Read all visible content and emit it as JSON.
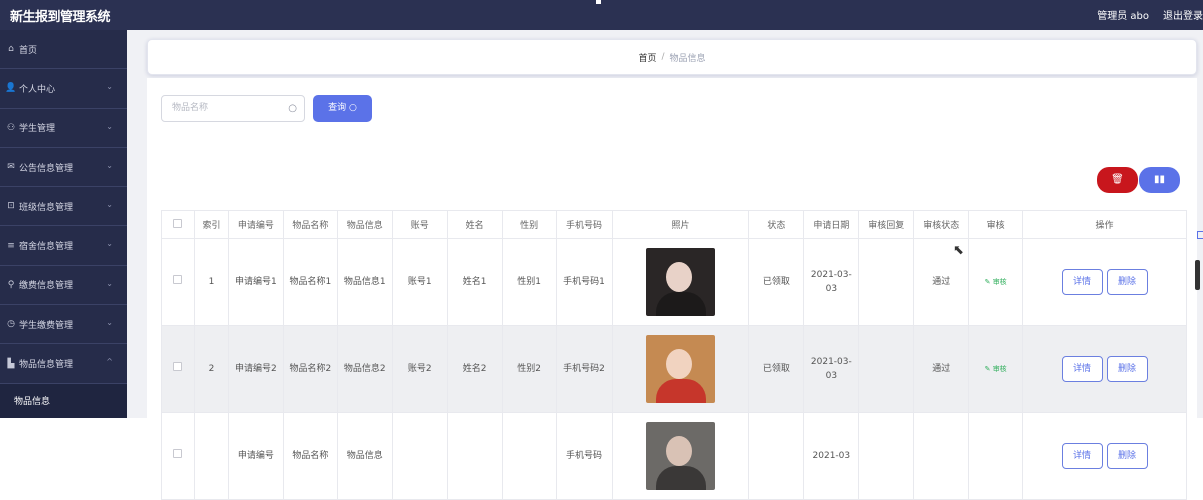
{
  "header": {
    "app_title": "新生报到管理系统",
    "user_label": "管理员 abo",
    "logout": "退出登录"
  },
  "sidebar": {
    "items": [
      {
        "label": "首页",
        "icon": "home-icon",
        "glyph": "⌂",
        "has_chevron": false
      },
      {
        "label": "个人中心",
        "icon": "user-icon",
        "glyph": "👤",
        "has_chevron": true
      },
      {
        "label": "学生管理",
        "icon": "student-icon",
        "glyph": "⚇",
        "has_chevron": true
      },
      {
        "label": "公告信息管理",
        "icon": "mail-icon",
        "glyph": "✉",
        "has_chevron": true
      },
      {
        "label": "班级信息管理",
        "icon": "crop-icon",
        "glyph": "⊡",
        "has_chevron": true
      },
      {
        "label": "宿舍信息管理",
        "icon": "list-icon",
        "glyph": "≡",
        "has_chevron": true
      },
      {
        "label": "缴费信息管理",
        "icon": "bulb-icon",
        "glyph": "⚲",
        "has_chevron": true
      },
      {
        "label": "学生缴费管理",
        "icon": "clock-icon",
        "glyph": "◷",
        "has_chevron": true
      },
      {
        "label": "物品信息管理",
        "icon": "chart-icon",
        "glyph": "▙",
        "has_chevron": true,
        "chevron": "^"
      }
    ],
    "sub_item": "物品信息",
    "chevron_glyph": "⌄"
  },
  "breadcrumb": {
    "home": "首页",
    "separator": "/",
    "current": "物品信息"
  },
  "search": {
    "placeholder": "物品名称",
    "button": "查询"
  },
  "icons": {
    "search": "search-icon",
    "delete": "trash-icon",
    "chart": "bar-chart-icon",
    "cursor": "mouse-cursor-icon"
  },
  "colors": {
    "topbar": "#2b3152",
    "sidebar": "#262c4a",
    "primary": "#5b72e8",
    "danger": "#c8161d",
    "audit_green": "#2fae5b"
  },
  "table": {
    "columns": [
      "索引",
      "申请编号",
      "物品名称",
      "物品信息",
      "账号",
      "姓名",
      "性别",
      "手机号码",
      "照片",
      "状态",
      "申请日期",
      "审核回复",
      "审核状态",
      "审核",
      "操作"
    ],
    "rows": [
      {
        "index": "1",
        "apply_no": "申请编号1",
        "item_name": "物品名称1",
        "item_info": "物品信息1",
        "account": "账号1",
        "name": "姓名1",
        "gender": "性别1",
        "phone": "手机号码1",
        "status": "已领取",
        "date": "2021-03-03",
        "reply": "",
        "audit_status": "通过",
        "audit_action": "审核"
      },
      {
        "index": "2",
        "apply_no": "申请编号2",
        "item_name": "物品名称2",
        "item_info": "物品信息2",
        "account": "账号2",
        "name": "姓名2",
        "gender": "性别2",
        "phone": "手机号码2",
        "status": "已领取",
        "date": "2021-03-03",
        "reply": "",
        "audit_status": "通过",
        "audit_action": "审核"
      },
      {
        "index": "",
        "apply_no": "申请编号",
        "item_name": "物品名称",
        "item_info": "物品信息",
        "account": "",
        "name": "",
        "gender": "",
        "phone": "手机号码",
        "status": "",
        "date": "2021-03",
        "reply": "",
        "audit_status": "",
        "audit_action": ""
      }
    ],
    "buttons": {
      "detail": "详情",
      "delete": "删除"
    }
  }
}
